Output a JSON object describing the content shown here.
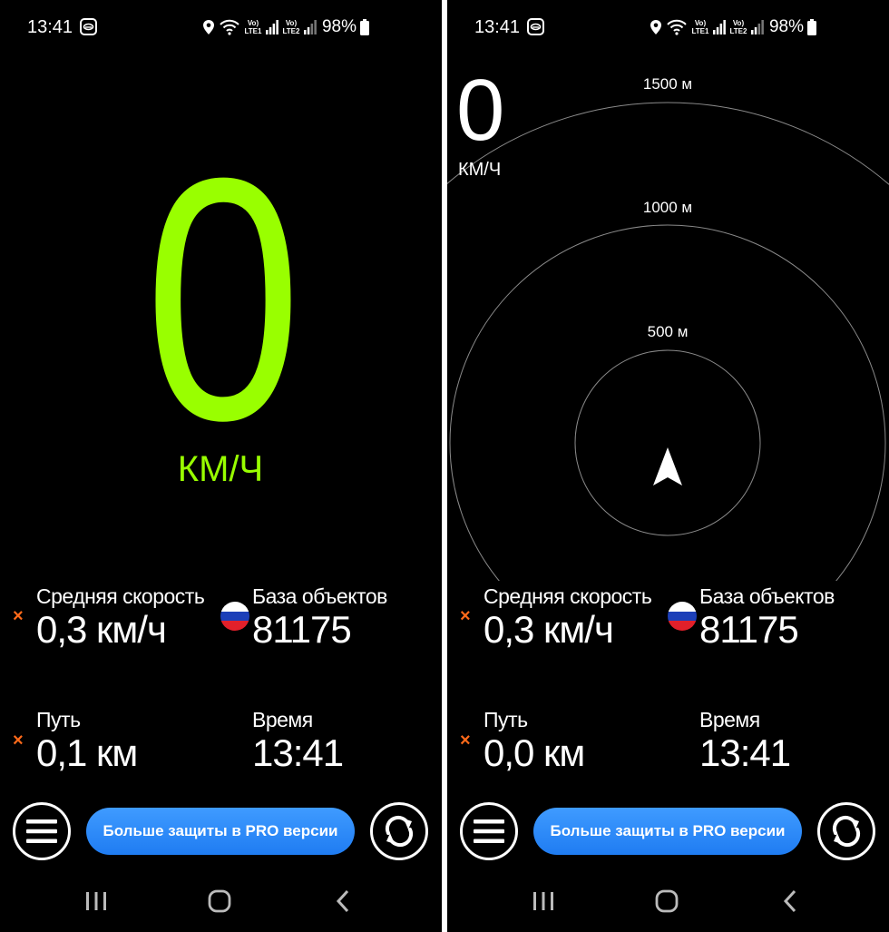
{
  "status_bar": {
    "time": "13:41",
    "battery": "98%",
    "sim1_label_top": "Vo)",
    "sim1_label_bottom": "LTE1",
    "sim2_label_top": "Vo)",
    "sim2_label_bottom": "LTE2",
    "icons": [
      "app-notification-icon",
      "location-icon",
      "wifi-icon",
      "signal-icon",
      "battery-icon"
    ]
  },
  "left_screen": {
    "speed": "0",
    "unit": "КМ/Ч",
    "speed_color": "#99ff00",
    "avg_speed_label": "Средняя скорость",
    "avg_speed_value": "0,3 км/ч",
    "database_label": "База объектов",
    "database_value": "81175",
    "distance_label": "Путь",
    "distance_value": "0,1 км",
    "time_label": "Время",
    "time_value": "13:41"
  },
  "right_screen": {
    "speed": "0",
    "unit": "КМ/Ч",
    "radar_labels": [
      "1500 м",
      "1000 м",
      "500 м"
    ],
    "avg_speed_label": "Средняя скорость",
    "avg_speed_value": "0,3 км/ч",
    "database_label": "База объектов",
    "database_value": "81175",
    "distance_label": "Путь",
    "distance_value": "0,0 км",
    "time_label": "Время",
    "time_value": "13:41"
  },
  "controls": {
    "pro_button": "Больше защиты в PRO версии",
    "reset_marker": "×",
    "accent_color": "#2a8bff"
  },
  "navigation": {
    "icons": [
      "recent-apps-icon",
      "home-icon",
      "back-icon"
    ]
  }
}
